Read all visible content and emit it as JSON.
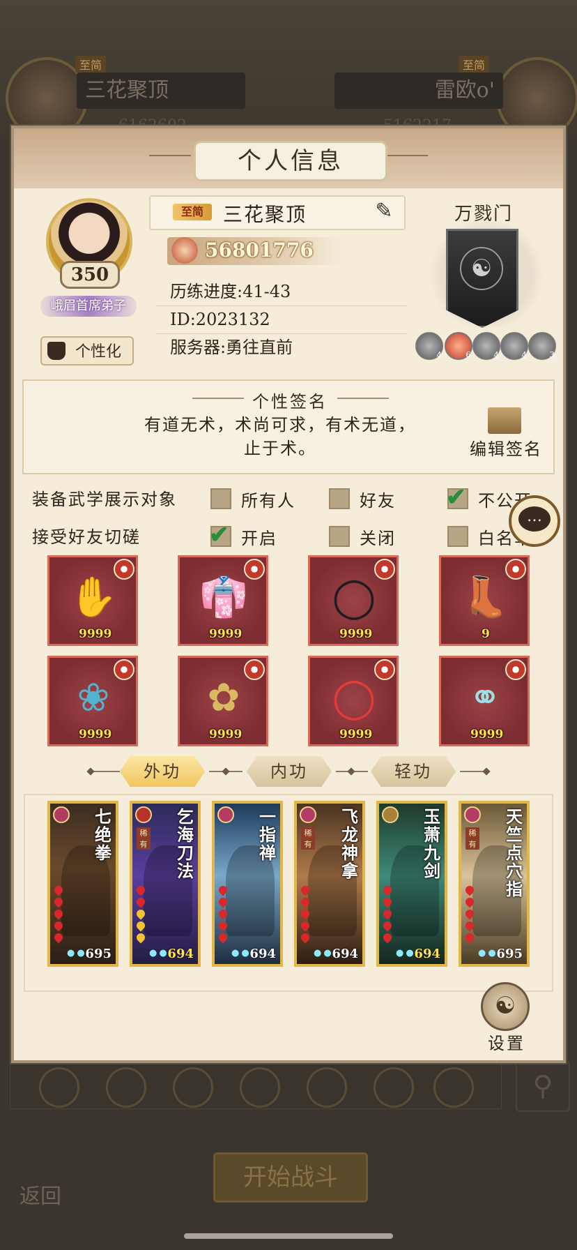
{
  "background": {
    "left_player": {
      "badge": "至简",
      "name": "三花聚顶",
      "score": "6162602"
    },
    "right_player": {
      "badge": "至简",
      "name": "雷欧o'",
      "score": "5162217"
    },
    "start_battle": "开始战斗",
    "back": "返回"
  },
  "panel": {
    "title": "个人信息",
    "profile": {
      "level": "350",
      "disciple_title": "峨眉首席弟子",
      "customize_label": "个性化",
      "vip_badge": "至简",
      "name": "三花聚顶",
      "power": "56801776",
      "progress": "历练进度:41-43",
      "id": "ID:2023132",
      "server": "服务器:勇往直前"
    },
    "sect": {
      "name": "万戮门",
      "badges": [
        "4",
        "6",
        "4",
        "4",
        "3"
      ]
    },
    "signature": {
      "title": "个性签名",
      "text_line1": "有道无术，术尚可求，有术无道，",
      "text_line2": "止于术。",
      "edit_label": "编辑签名"
    },
    "settings": {
      "equip_display": {
        "label": "装备武学展示对象",
        "options": [
          {
            "label": "所有人",
            "checked": false
          },
          {
            "label": "好友",
            "checked": false
          },
          {
            "label": "不公开",
            "checked": true
          }
        ]
      },
      "friend_spar": {
        "label": "接受好友切磋",
        "options": [
          {
            "label": "开启",
            "checked": true
          },
          {
            "label": "关闭",
            "checked": false
          },
          {
            "label": "白名单",
            "checked": false
          }
        ]
      }
    },
    "equipment": [
      {
        "name": "glove",
        "qty": "9999"
      },
      {
        "name": "robe",
        "qty": "9999"
      },
      {
        "name": "belt",
        "qty": "9999"
      },
      {
        "name": "boots",
        "qty": "9"
      },
      {
        "name": "necklace",
        "qty": "9999"
      },
      {
        "name": "hairpin",
        "qty": "9999"
      },
      {
        "name": "bracelet",
        "qty": "9999"
      },
      {
        "name": "ring",
        "qty": "9999"
      }
    ],
    "tabs": [
      "外功",
      "内功",
      "轻功"
    ],
    "skills": [
      {
        "name": "七绝拳",
        "level": "695",
        "rare": ""
      },
      {
        "name": "乞海刀法",
        "level": "694",
        "rare": "稀有"
      },
      {
        "name": "一指禅",
        "level": "694",
        "rare": ""
      },
      {
        "name": "飞龙神拿",
        "level": "694",
        "rare": "稀有"
      },
      {
        "name": "玉萧九剑",
        "level": "694",
        "rare": ""
      },
      {
        "name": "天竺点穴指",
        "level": "695",
        "rare": "稀有"
      }
    ],
    "settings_button": "设置"
  },
  "colors": {
    "accent_gold": "#e3b747",
    "panel_bg": "#f5ecd9",
    "equip_bg": "#7d2d32",
    "check_green": "#2a8d3b"
  }
}
